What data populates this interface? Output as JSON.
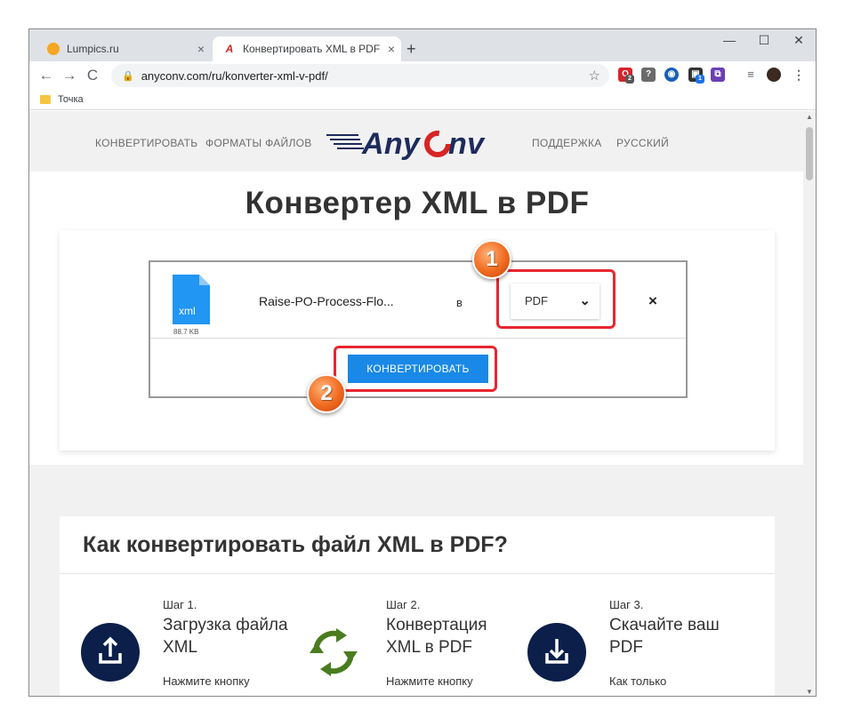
{
  "browser": {
    "tabs": [
      {
        "title": "Lumpics.ru",
        "close": "×"
      },
      {
        "title": "Конвертировать XML в PDF онл",
        "close": "×"
      }
    ],
    "new_tab": "+",
    "window_controls": {
      "minimize": "—",
      "maximize": "☐",
      "close": "✕"
    },
    "nav": {
      "back": "←",
      "forward": "→",
      "reload": "C"
    },
    "url": "anyconv.com/ru/konverter-xml-v-pdf/",
    "extension_badges": [
      "2",
      "1"
    ],
    "bookmark": "Точка"
  },
  "site": {
    "nav": {
      "convert": "КОНВЕРТИРОВАТЬ",
      "formats": "ФОРМАТЫ ФАЙЛОВ",
      "support": "ПОДДЕРЖКА",
      "language": "РУССКИЙ"
    },
    "logo": "AnyConv",
    "heading": "Конвертер XML в PDF",
    "file": {
      "icon_label": "xml",
      "size": "88.7 KB",
      "name": "Raise-PO-Process-Flo...",
      "to_word": "в",
      "format_selected": "PDF",
      "remove": "×"
    },
    "convert_button": "КОНВЕРТИРОВАТЬ",
    "markers": [
      "1",
      "2"
    ],
    "howto": {
      "title": "Как конвертировать файл XML в PDF?",
      "steps": [
        {
          "label": "Шаг 1.",
          "title": "Загрузка файла XML",
          "desc": "Нажмите кнопку"
        },
        {
          "label": "Шаг 2.",
          "title": "Конвертация XML в PDF",
          "desc": "Нажмите кнопку"
        },
        {
          "label": "Шаг 3.",
          "title": "Скачайте ваш PDF",
          "desc": "Как только"
        }
      ]
    }
  },
  "colors": {
    "convert_button": "#1a88e6",
    "highlight": "#e8262f",
    "marker": "#f06a1f",
    "step_icon_bg": "#0b1f4a",
    "refresh_icon": "#4a7c1f"
  }
}
